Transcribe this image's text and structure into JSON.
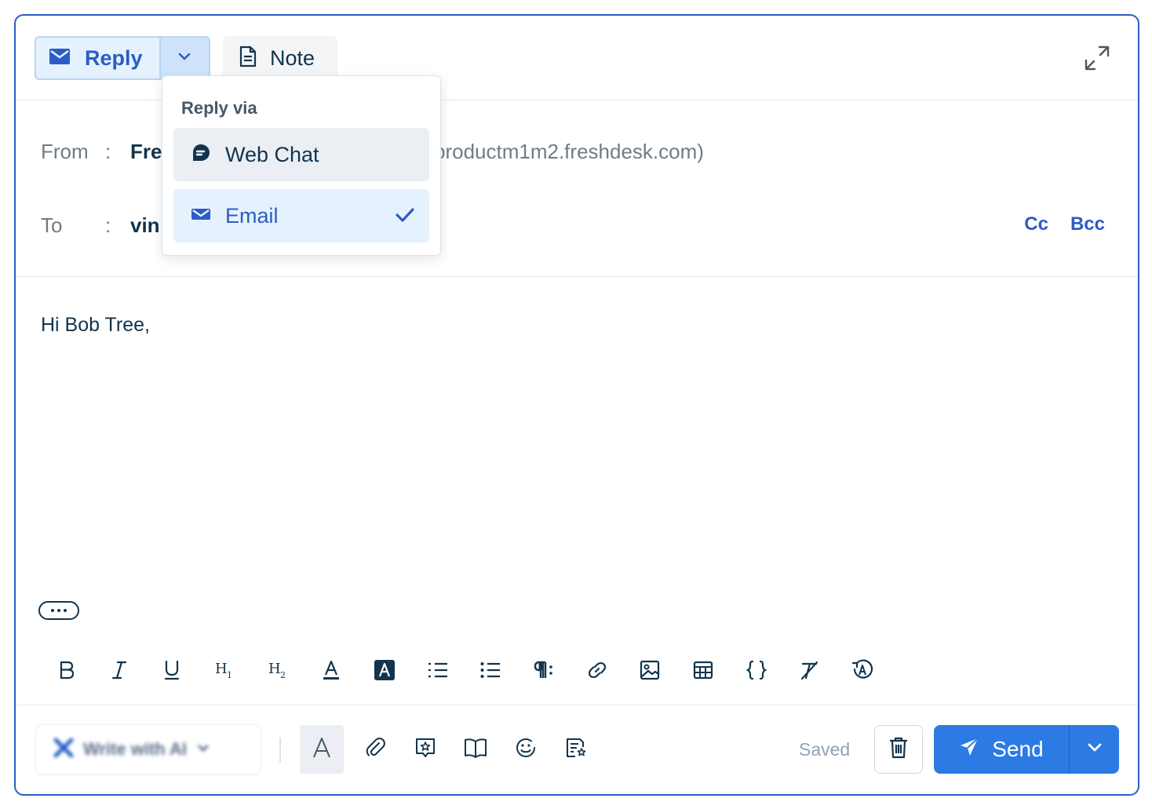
{
  "header": {
    "reply_label": "Reply",
    "note_label": "Note"
  },
  "reply_dropdown": {
    "heading": "Reply via",
    "items": [
      {
        "label": "Web Chat",
        "icon": "chat-bubble-icon",
        "selected": false
      },
      {
        "label": "Email",
        "icon": "envelope-icon",
        "selected": true
      }
    ]
  },
  "fields": {
    "from_label": "From",
    "from_value": "Fre",
    "from_email": "productm1m2.freshdesk.com)",
    "to_label": "To",
    "to_value": "vin",
    "separator": ":",
    "cc_label": "Cc",
    "bcc_label": "Bcc"
  },
  "body": {
    "greeting": "Hi Bob Tree,"
  },
  "formatting_toolbar": [
    "bold-icon",
    "italic-icon",
    "underline-icon",
    "heading-1-icon",
    "heading-2-icon",
    "text-color-icon",
    "highlight-icon",
    "ordered-list-icon",
    "unordered-list-icon",
    "paragraph-icon",
    "link-icon",
    "image-icon",
    "table-icon",
    "code-icon",
    "clear-format-icon",
    "spellcheck-icon"
  ],
  "footer": {
    "ai_label": "Write with AI",
    "saved_label": "Saved",
    "send_label": "Send"
  },
  "colors": {
    "accent": "#2c5cc5",
    "send_button": "#2c7be5",
    "panel_border": "#2c5cc5",
    "text": "#12344d",
    "muted": "#6f7c87"
  }
}
